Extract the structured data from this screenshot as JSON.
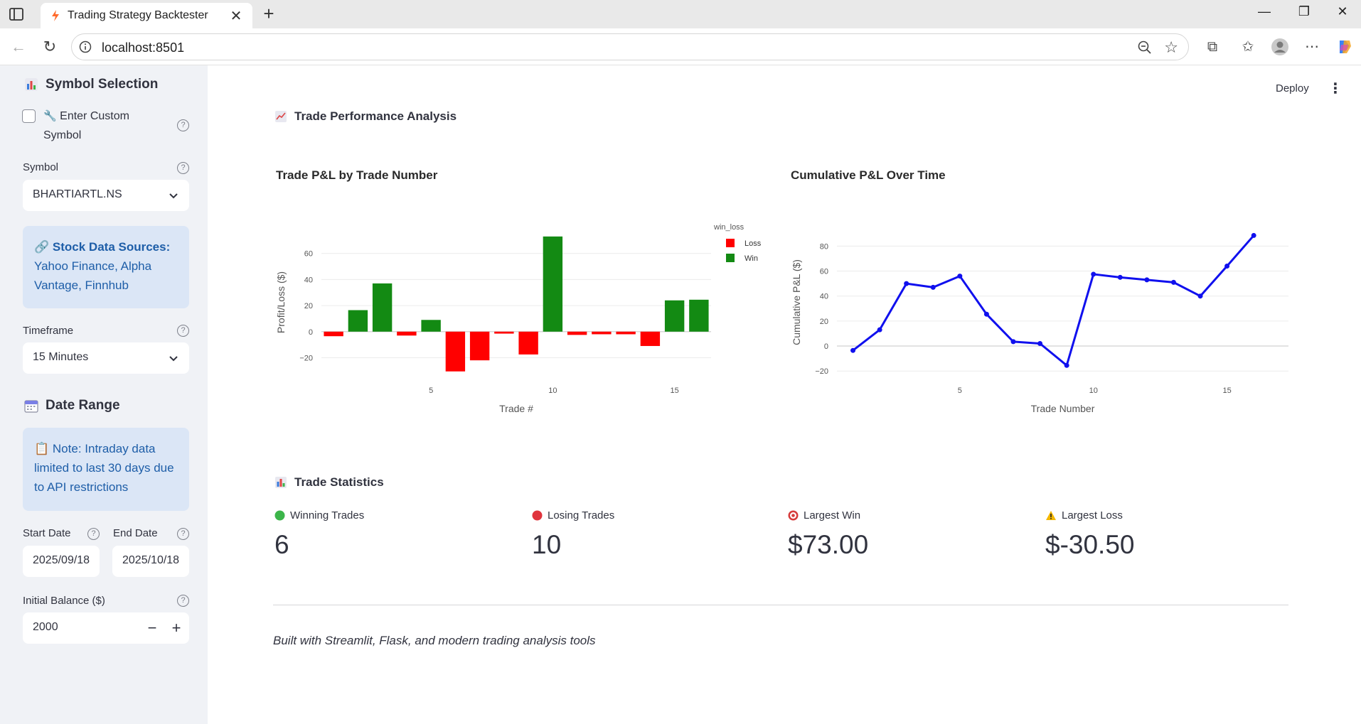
{
  "browser": {
    "tab_title": "Trading Strategy Backtester",
    "url": "localhost:8501"
  },
  "sidebar": {
    "symbol_selection_heading": "Symbol Selection",
    "custom_symbol_label": "Enter Custom Symbol",
    "custom_symbol_checked": false,
    "symbol_label": "Symbol",
    "symbol_value": "BHARTIARTL.NS",
    "data_sources_title": "Stock Data Sources:",
    "data_sources_text": "Yahoo Finance, Alpha Vantage, Finnhub",
    "timeframe_label": "Timeframe",
    "timeframe_value": "15 Minutes",
    "date_range_heading": "Date Range",
    "intraday_note": "Note: Intraday data limited to last 30 days due to API restrictions",
    "start_date_label": "Start Date",
    "start_date_value": "2025/09/18",
    "end_date_label": "End Date",
    "end_date_value": "2025/10/18",
    "initial_balance_label": "Initial Balance ($)",
    "initial_balance_value": "2000",
    "minus": "−",
    "plus": "+"
  },
  "header": {
    "deploy_label": "Deploy"
  },
  "main": {
    "section_title": "Trade Performance Analysis",
    "stats_title": "Trade Statistics",
    "footer": "Built with Streamlit, Flask, and modern trading analysis tools"
  },
  "metrics": [
    {
      "label": "Winning Trades",
      "value": "6",
      "icon": "green-circle-icon",
      "color": "#3cb54a"
    },
    {
      "label": "Losing Trades",
      "value": "10",
      "icon": "red-circle-icon",
      "color": "#e0343d"
    },
    {
      "label": "Largest Win",
      "value": "$73.00",
      "icon": "target-icon",
      "color": "#d63b3b"
    },
    {
      "label": "Largest Loss",
      "value": "$-30.50",
      "icon": "warning-icon",
      "color": "#f2b600"
    }
  ],
  "colors": {
    "win": "#138a13",
    "loss": "#ff0000",
    "line": "#1010ee",
    "accent": "#ff4b4b"
  },
  "chart_data": [
    {
      "type": "bar",
      "title": "Trade P&L by Trade Number",
      "xlabel": "Trade #",
      "ylabel": "Profit/Loss ($)",
      "x": [
        1,
        2,
        3,
        4,
        5,
        6,
        7,
        8,
        9,
        10,
        11,
        12,
        13,
        14,
        15,
        16
      ],
      "values": [
        -3.5,
        16.5,
        37.0,
        -3.0,
        9.0,
        -30.5,
        -22.0,
        -1.5,
        -17.5,
        73.0,
        -2.5,
        -2.0,
        -2.0,
        -11.0,
        24.0,
        24.5
      ],
      "legend_title": "win_loss",
      "legend": [
        "Loss",
        "Win"
      ],
      "legend_position": "top-right",
      "xticks": [
        5,
        10,
        15
      ],
      "yticks": [
        -20,
        0,
        20,
        40,
        60
      ],
      "ylim": [
        -35,
        80
      ],
      "grid": true
    },
    {
      "type": "line",
      "title": "Cumulative P&L Over Time",
      "xlabel": "Trade Number",
      "ylabel": "Cumulative P&L ($)",
      "x": [
        1,
        2,
        3,
        4,
        5,
        6,
        7,
        8,
        9,
        10,
        11,
        12,
        13,
        14,
        15,
        16
      ],
      "values": [
        -3.5,
        13.0,
        50.0,
        47.0,
        56.0,
        25.5,
        3.5,
        2.0,
        -15.5,
        57.5,
        55.0,
        53.0,
        51.0,
        40.0,
        64.0,
        88.5
      ],
      "xticks": [
        5,
        10,
        15
      ],
      "yticks": [
        -20,
        0,
        20,
        40,
        60,
        80
      ],
      "ylim": [
        -25,
        95
      ],
      "grid": true
    }
  ]
}
